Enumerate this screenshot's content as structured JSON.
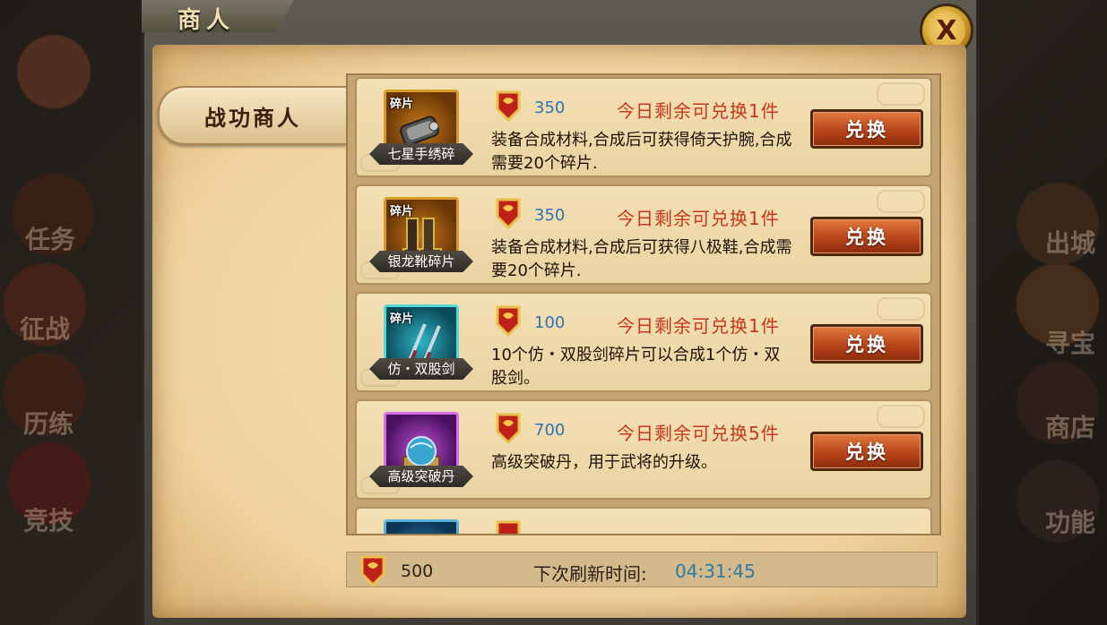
{
  "window": {
    "title": "商人",
    "close_label": "X"
  },
  "sidebar": {
    "tab_label": "战功商人"
  },
  "items": [
    {
      "name": "七星手绣碎",
      "frag_tag": "碎片",
      "icon": "bracer-fragment-icon",
      "cost": "350",
      "limit": "今日剩余可兑换1件",
      "desc": "装备合成材料,合成后可获得倚天护腕,合成需要20个碎片.",
      "button": "兑换"
    },
    {
      "name": "银龙靴碎片",
      "frag_tag": "碎片",
      "icon": "boots-fragment-icon",
      "cost": "350",
      "limit": "今日剩余可兑换1件",
      "desc": "装备合成材料,合成后可获得八极鞋,合成需要20个碎片.",
      "button": "兑换"
    },
    {
      "name": "仿・双股剑",
      "frag_tag": "碎片",
      "icon": "twin-sword-fragment-icon",
      "cost": "100",
      "limit": "今日剩余可兑换1件",
      "desc": "10个仿・双股剑碎片可以合成1个仿・双股剑。",
      "button": "兑换"
    },
    {
      "name": "高级突破丹",
      "frag_tag": "",
      "icon": "breakthrough-pill-icon",
      "cost": "700",
      "limit": "今日剩余可兑换5件",
      "desc": "高级突破丹，用于武将的升级。",
      "button": "兑换"
    }
  ],
  "footer": {
    "owned": "500",
    "refresh_label": "下次刷新时间:",
    "refresh_time": "04:31:45"
  },
  "background": {
    "left_labels": [
      "任务",
      "征战",
      "历练",
      "竞技"
    ],
    "right_labels": [
      "出城",
      "寻宝",
      "商店",
      "功能"
    ]
  },
  "colors": {
    "cost": "#2f72b8",
    "limit": "#c5381b",
    "timer": "#2a7ca6",
    "button": "#b9441a"
  }
}
